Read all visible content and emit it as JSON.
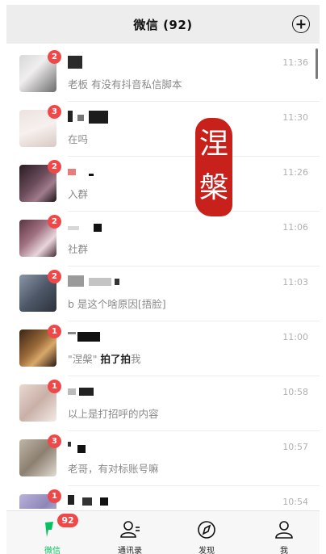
{
  "header": {
    "title": "微信 (92)"
  },
  "chats": [
    {
      "badge": "2",
      "preview_prefix": "",
      "preview_bold": "",
      "preview": "老板  有没有抖音私信脚本",
      "time": "11:36"
    },
    {
      "badge": "3",
      "preview_prefix": "",
      "preview_bold": "",
      "preview": "在吗",
      "time": "11:30"
    },
    {
      "badge": "2",
      "preview_prefix": "",
      "preview_bold": "",
      "preview": "入群",
      "time": "11:26"
    },
    {
      "badge": "2",
      "preview_prefix": "",
      "preview_bold": "",
      "preview": "社群",
      "time": "11:06"
    },
    {
      "badge": "2",
      "preview_prefix": "",
      "preview_bold": "",
      "preview": "b 是这个啥原因[捂脸]",
      "time": "11:03"
    },
    {
      "badge": "1",
      "preview_prefix": "\"涅槃\" ",
      "preview_bold": "拍了拍",
      "preview": "我",
      "time": "11:00"
    },
    {
      "badge": "1",
      "preview_prefix": "",
      "preview_bold": "",
      "preview": "以上是打招呼的内容",
      "time": "10:58"
    },
    {
      "badge": "3",
      "preview_prefix": "",
      "preview_bold": "",
      "preview": "老哥，有对标账号嘛",
      "time": "10:57"
    },
    {
      "badge": "1",
      "preview_prefix": "",
      "preview_bold": "",
      "preview": "",
      "time": "10:54"
    }
  ],
  "seal": {
    "text": "涅槃"
  },
  "tabs": [
    {
      "label": "微信",
      "icon": "chat-icon",
      "badge": "92",
      "active": true
    },
    {
      "label": "通讯录",
      "icon": "contacts-icon"
    },
    {
      "label": "发现",
      "icon": "compass-icon"
    },
    {
      "label": "我",
      "icon": "person-icon"
    }
  ],
  "colors": {
    "accent": "#07c160",
    "badge": "#f04848",
    "seal": "#c8211c",
    "header_bg": "#ededed"
  }
}
